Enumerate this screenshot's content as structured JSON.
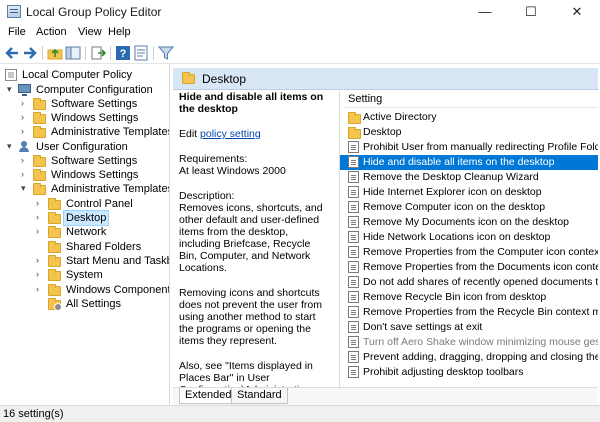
{
  "window": {
    "title": "Local Group Policy Editor",
    "minimize": "—",
    "maximize": "☐",
    "close": "✕"
  },
  "menu": [
    "File",
    "Action",
    "View",
    "Help"
  ],
  "toolbar": {
    "icons": [
      "back-arrow-icon",
      "forward-arrow-icon",
      "up-folder-icon",
      "show-hide-tree-icon",
      "export-list-icon",
      "help-icon",
      "properties-icon",
      "filter-icon"
    ]
  },
  "tree": {
    "items": [
      {
        "label": "Local Computer Policy",
        "level": 0,
        "icon": "policy-icon",
        "expander": ""
      },
      {
        "label": "Computer Configuration",
        "level": 1,
        "icon": "computer-icon",
        "expander": "▾"
      },
      {
        "label": "Software Settings",
        "level": 2,
        "icon": "folder-icon",
        "expander": "›"
      },
      {
        "label": "Windows Settings",
        "level": 2,
        "icon": "folder-icon",
        "expander": "›"
      },
      {
        "label": "Administrative Templates",
        "level": 2,
        "icon": "folder-icon",
        "expander": "›"
      },
      {
        "label": "User Configuration",
        "level": 1,
        "icon": "user-icon",
        "expander": "▾"
      },
      {
        "label": "Software Settings",
        "level": 2,
        "icon": "folder-icon",
        "expander": "›"
      },
      {
        "label": "Windows Settings",
        "level": 2,
        "icon": "folder-icon",
        "expander": "›"
      },
      {
        "label": "Administrative Templates",
        "level": 2,
        "icon": "folder-icon",
        "expander": "▾"
      },
      {
        "label": "Control Panel",
        "level": 3,
        "icon": "folder-icon",
        "expander": "›"
      },
      {
        "label": "Desktop",
        "level": 3,
        "icon": "folder-icon",
        "expander": "›",
        "selected": true
      },
      {
        "label": "Network",
        "level": 3,
        "icon": "folder-icon",
        "expander": "›"
      },
      {
        "label": "Shared Folders",
        "level": 3,
        "icon": "folder-icon",
        "expander": ""
      },
      {
        "label": "Start Menu and Taskbar",
        "level": 3,
        "icon": "folder-icon",
        "expander": "›"
      },
      {
        "label": "System",
        "level": 3,
        "icon": "folder-icon",
        "expander": "›"
      },
      {
        "label": "Windows Components",
        "level": 3,
        "icon": "folder-icon",
        "expander": "›"
      },
      {
        "label": "All Settings",
        "level": 3,
        "icon": "folder-gear-icon",
        "expander": ""
      }
    ]
  },
  "right_header": {
    "label": "Desktop"
  },
  "description": {
    "title": "Hide and disable all items on the desktop",
    "edit_prefix": "Edit ",
    "edit_link": "policy setting",
    "requirements_label": "Requirements:",
    "requirements_value": "At least Windows 2000",
    "description_label": "Description:",
    "paragraph1": "Removes icons, shortcuts, and other default and user-defined items from the desktop, including Briefcase, Recycle Bin, Computer, and Network Locations.",
    "paragraph2": "Removing icons and shortcuts does not prevent the user from using another method to start the programs or opening the items they represent.",
    "paragraph3": "Also, see \"Items displayed in Places Bar\" in User Configuration\\Administrative Templates\\Windows"
  },
  "list": {
    "header": "Setting",
    "rows": [
      {
        "label": "Active Directory",
        "icon": "folder-icon"
      },
      {
        "label": "Desktop",
        "icon": "folder-icon"
      },
      {
        "label": "Prohibit User from manually redirecting Profile Folders",
        "icon": "policy-setting-icon"
      },
      {
        "label": "Hide and disable all items on the desktop",
        "icon": "policy-setting-icon",
        "selected": true
      },
      {
        "label": "Remove the Desktop Cleanup Wizard",
        "icon": "policy-setting-icon"
      },
      {
        "label": "Hide Internet Explorer icon on desktop",
        "icon": "policy-setting-icon"
      },
      {
        "label": "Remove Computer icon on the desktop",
        "icon": "policy-setting-icon"
      },
      {
        "label": "Remove My Documents icon on the desktop",
        "icon": "policy-setting-icon"
      },
      {
        "label": "Hide Network Locations icon on desktop",
        "icon": "policy-setting-icon"
      },
      {
        "label": "Remove Properties from the Computer icon context menu",
        "icon": "policy-setting-icon"
      },
      {
        "label": "Remove Properties from the Documents icon context menu",
        "icon": "policy-setting-icon"
      },
      {
        "label": "Do not add shares of recently opened documents to Network Locations",
        "icon": "policy-setting-icon"
      },
      {
        "label": "Remove Recycle Bin icon from desktop",
        "icon": "policy-setting-icon"
      },
      {
        "label": "Remove Properties from the Recycle Bin context menu",
        "icon": "policy-setting-icon"
      },
      {
        "label": "Don't save settings at exit",
        "icon": "policy-setting-icon"
      },
      {
        "label": "Turn off Aero Shake window minimizing mouse gesture",
        "icon": "policy-setting-icon",
        "dim": true
      },
      {
        "label": "Prevent adding, dragging, dropping and closing the Taskbar's toolbars",
        "icon": "policy-setting-icon"
      },
      {
        "label": "Prohibit adjusting desktop toolbars",
        "icon": "policy-setting-icon"
      }
    ]
  },
  "tabs": [
    {
      "label": "Extended",
      "active": true
    },
    {
      "label": "Standard",
      "active": false
    }
  ],
  "status": {
    "text": "16 setting(s)"
  }
}
